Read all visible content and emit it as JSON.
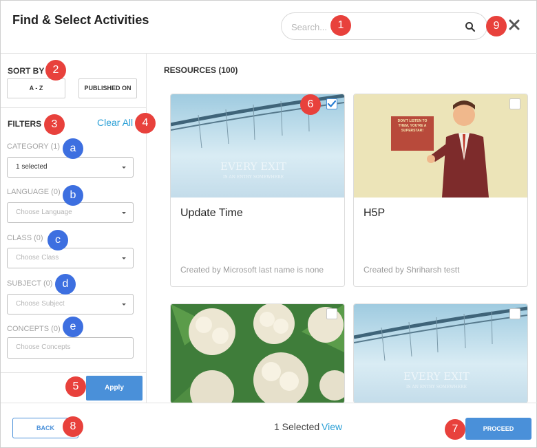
{
  "header": {
    "title": "Find & Select Activities",
    "search_placeholder": "Search..."
  },
  "sidebar": {
    "sort_label": "SORT BY",
    "sort_options": [
      "A - Z",
      "PUBLISHED ON"
    ],
    "filters_label": "FILTERS",
    "clear_all": "Clear All",
    "filters": [
      {
        "label": "CATEGORY (1)",
        "value": "1 selected",
        "state": "selected"
      },
      {
        "label": "LANGUAGE (0)",
        "value": "Choose Language",
        "state": "placeholder"
      },
      {
        "label": "CLASS (0)",
        "value": "Choose Class",
        "state": "placeholder"
      },
      {
        "label": "SUBJECT (0)",
        "value": "Choose Subject",
        "state": "placeholder"
      },
      {
        "label": "CONCEPTS (0)",
        "value": "Choose Concepts",
        "state": "placeholder"
      }
    ],
    "apply": "Apply"
  },
  "main": {
    "resources_title": "RESOURCES (100)",
    "cards": [
      {
        "title": "Update Time",
        "meta": "Created by Microsoft last name is none",
        "checked": true,
        "thumb": "bridge",
        "thumb_text": "EVERY EXIT",
        "thumb_subtext": "IS AN ENTRY SOMEWHERE"
      },
      {
        "title": "H5P",
        "meta": "Created by Shriharsh testt",
        "checked": false,
        "thumb": "poster",
        "thumb_text": "DON'T LISTEN TO THEM, YOU'RE A SUPERSTAR!"
      },
      {
        "title": "",
        "meta": "",
        "checked": false,
        "thumb": "cauliflower"
      },
      {
        "title": "",
        "meta": "",
        "checked": false,
        "thumb": "bridge",
        "thumb_text": "EVERY EXIT",
        "thumb_subtext": "IS AN ENTRY SOMEWHERE"
      }
    ]
  },
  "footer": {
    "back": "BACK",
    "selected_count": "1 Selected",
    "view": "View",
    "proceed": "PROCEED"
  },
  "markers": [
    {
      "label": "1",
      "color": "red"
    },
    {
      "label": "2",
      "color": "red"
    },
    {
      "label": "3",
      "color": "red"
    },
    {
      "label": "4",
      "color": "red"
    },
    {
      "label": "5",
      "color": "red"
    },
    {
      "label": "6",
      "color": "red"
    },
    {
      "label": "7",
      "color": "red"
    },
    {
      "label": "8",
      "color": "red"
    },
    {
      "label": "9",
      "color": "red"
    },
    {
      "label": "a",
      "color": "blue"
    },
    {
      "label": "b",
      "color": "blue"
    },
    {
      "label": "c",
      "color": "blue"
    },
    {
      "label": "d",
      "color": "blue"
    },
    {
      "label": "e",
      "color": "blue"
    }
  ],
  "colors": {
    "accent": "#4a90d9",
    "link": "#2a9fd6",
    "marker_red": "#e8413c",
    "marker_blue": "#3d6fe0"
  }
}
